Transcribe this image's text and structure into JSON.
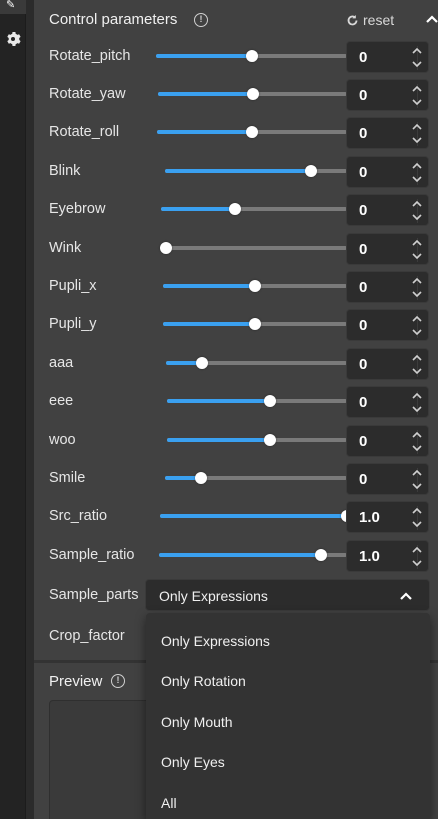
{
  "panel": {
    "title": "Control parameters",
    "reset_label": "reset"
  },
  "params": [
    {
      "label": "Rotate_pitch",
      "value": "0",
      "level": 0.5
    },
    {
      "label": "Rotate_yaw",
      "value": "0",
      "level": 0.5
    },
    {
      "label": "Rotate_roll",
      "value": "0",
      "level": 0.5
    },
    {
      "label": "Blink",
      "value": "0",
      "level": 0.8
    },
    {
      "label": "Eyebrow",
      "value": "0",
      "level": 0.4
    },
    {
      "label": "Wink",
      "value": "0",
      "level": 0.0
    },
    {
      "label": "Pupli_x",
      "value": "0",
      "level": 0.5
    },
    {
      "label": "Pupli_y",
      "value": "0",
      "level": 0.5
    },
    {
      "label": "aaa",
      "value": "0",
      "level": 0.2
    },
    {
      "label": "eee",
      "value": "0",
      "level": 0.57
    },
    {
      "label": "woo",
      "value": "0",
      "level": 0.57
    },
    {
      "label": "Smile",
      "value": "0",
      "level": 0.2
    },
    {
      "label": "Src_ratio",
      "value": "1.0",
      "level": 1.0
    },
    {
      "label": "Sample_ratio",
      "value": "1.0",
      "level": 0.86
    }
  ],
  "sample_parts": {
    "label": "Sample_parts",
    "selected": "Only Expressions",
    "options": [
      "Only Expressions",
      "Only Rotation",
      "Only Mouth",
      "Only Eyes",
      "All"
    ]
  },
  "crop_factor": {
    "label": "Crop_factor"
  },
  "preview": {
    "title": "Preview"
  },
  "colors": {
    "accent": "#3aa0f0",
    "panel": "#414141",
    "input": "#2c2c2c"
  }
}
